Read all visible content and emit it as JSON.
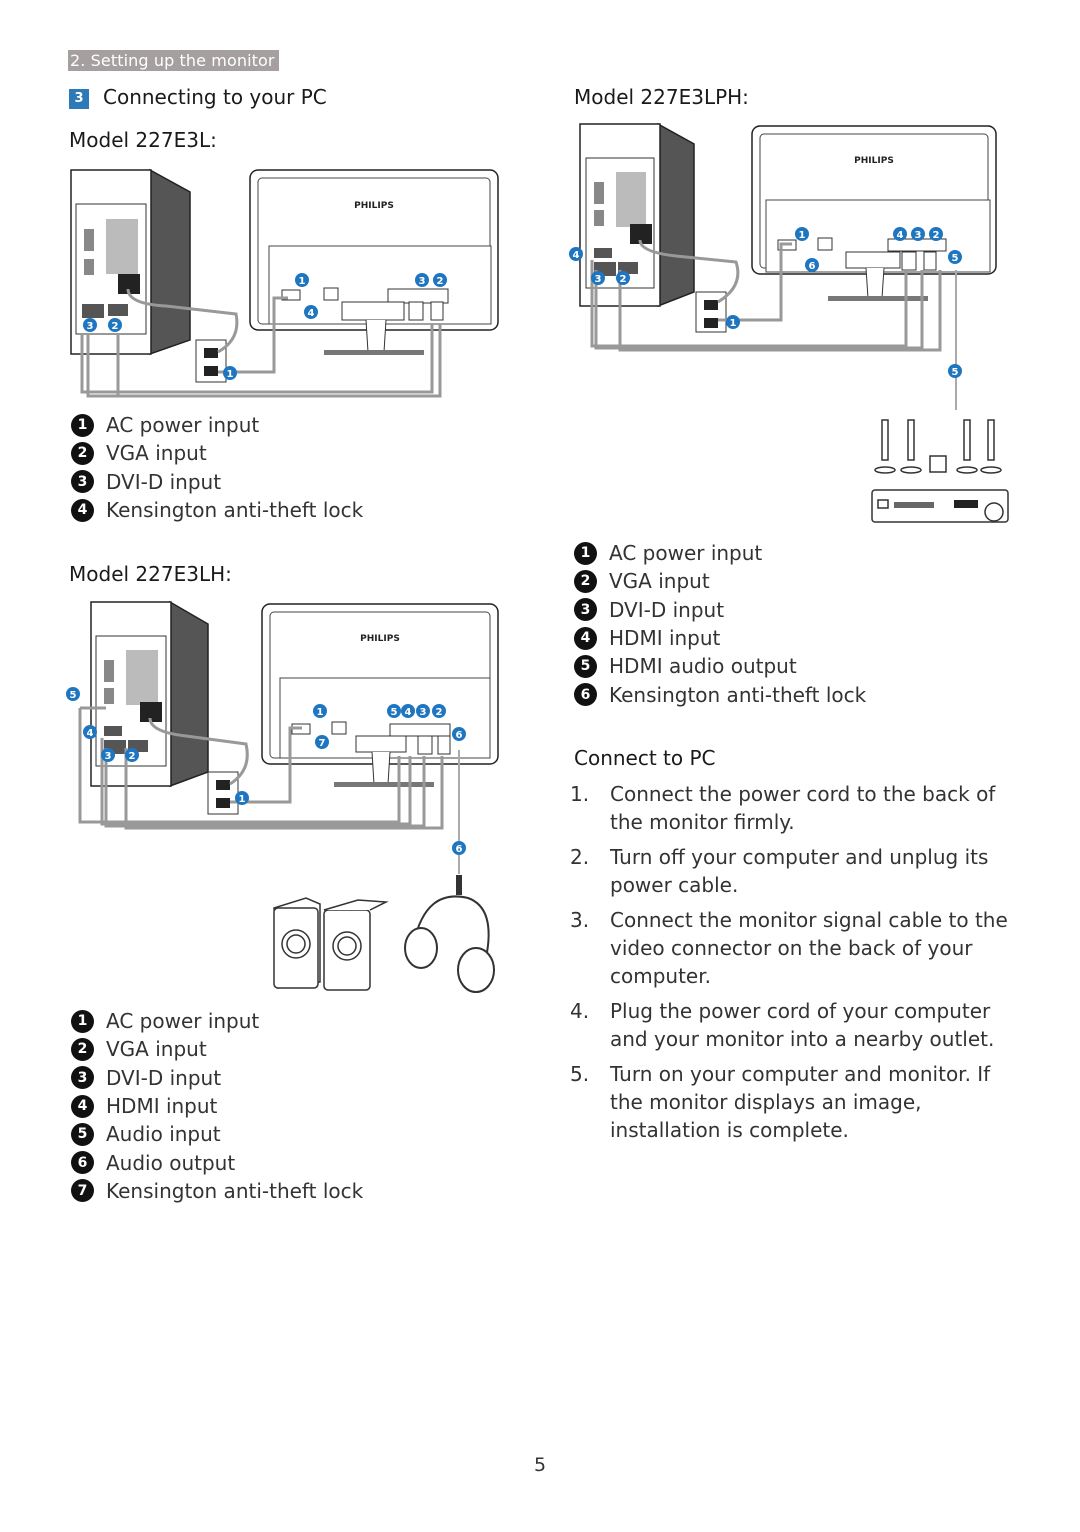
{
  "header": {
    "section": "2. Setting up the monitor",
    "step_number": "3",
    "step_title": "Connecting to your PC"
  },
  "brand": "PHILIPS",
  "colors": {
    "accent": "#2e7ab8",
    "tag_bg": "#a59f9f",
    "callout": "#1f76c0"
  },
  "models": [
    {
      "title": "Model 227E3L:",
      "legend": [
        {
          "n": "1",
          "label": "AC power input"
        },
        {
          "n": "2",
          "label": "VGA input"
        },
        {
          "n": "3",
          "label": "DVI-D input"
        },
        {
          "n": "4",
          "label": "Kensington anti-theft lock"
        }
      ]
    },
    {
      "title": "Model 227E3LH:",
      "legend": [
        {
          "n": "1",
          "label": "AC power input"
        },
        {
          "n": "2",
          "label": "VGA input"
        },
        {
          "n": "3",
          "label": "DVI-D input"
        },
        {
          "n": "4",
          "label": "HDMI input"
        },
        {
          "n": "5",
          "label": "Audio input"
        },
        {
          "n": "6",
          "label": "Audio output"
        },
        {
          "n": "7",
          "label": "Kensington anti-theft lock"
        }
      ]
    },
    {
      "title": "Model 227E3LPH:",
      "legend": [
        {
          "n": "1",
          "label": "AC power input"
        },
        {
          "n": "2",
          "label": "VGA input"
        },
        {
          "n": "3",
          "label": "DVI-D input"
        },
        {
          "n": "4",
          "label": "HDMI input"
        },
        {
          "n": "5",
          "label": "HDMI audio output"
        },
        {
          "n": "6",
          "label": "Kensington anti-theft lock"
        }
      ]
    }
  ],
  "diagram_callouts": {
    "m1": [
      "1",
      "3",
      "2",
      "4",
      "3",
      "2",
      "1"
    ],
    "m2": [
      "1",
      "5",
      "4",
      "3",
      "2",
      "6",
      "7",
      "5",
      "4",
      "3",
      "2",
      "1",
      "6"
    ],
    "m3": [
      "1",
      "4",
      "3",
      "2",
      "5",
      "6",
      "4",
      "3",
      "2",
      "1",
      "5"
    ]
  },
  "connect": {
    "title": "Connect to PC",
    "steps": [
      {
        "n": "1.",
        "text": "Connect the power cord to the back of the monitor firmly."
      },
      {
        "n": "2.",
        "text": "Turn off your computer and unplug its power cable."
      },
      {
        "n": "3.",
        "text": "Connect the monitor signal cable to the video connector on the back of your computer."
      },
      {
        "n": "4.",
        "text": "Plug the power cord of your computer and your monitor into a nearby outlet."
      },
      {
        "n": "5.",
        "text": "Turn on your computer and monitor. If the monitor displays an image,  installation is complete."
      }
    ]
  },
  "page_number": "5"
}
